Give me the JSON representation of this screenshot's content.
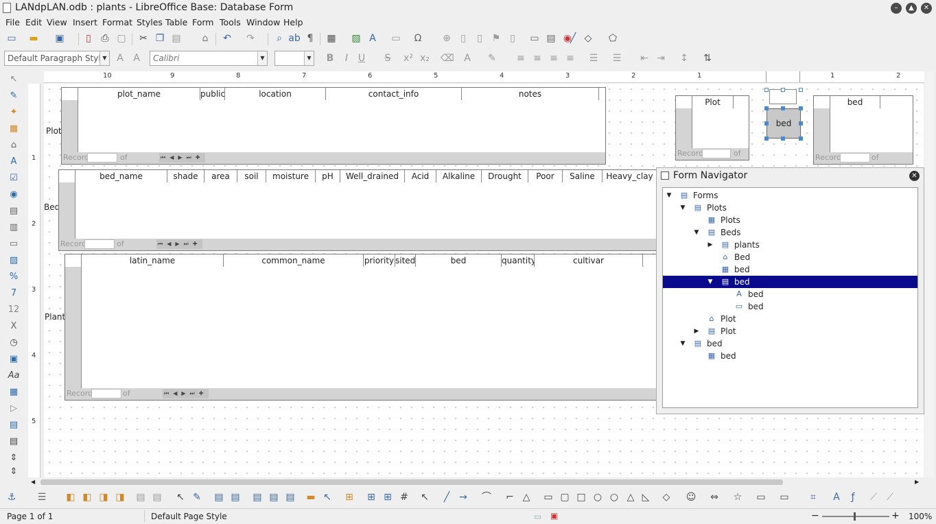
{
  "window": {
    "title": "LANdpLAN.odb : plants - LibreOffice Base: Database Form"
  },
  "menu": [
    "File",
    "Edit",
    "View",
    "Insert",
    "Format",
    "Styles",
    "Table",
    "Form",
    "Tools",
    "Window",
    "Help"
  ],
  "format_bar": {
    "paragraph_style": "Default Paragraph Style",
    "font_name": "Calibri",
    "font_size": ""
  },
  "ruler_numbers": [
    "10",
    "9",
    "8",
    "7",
    "6",
    "5",
    "4",
    "3",
    "2",
    "1",
    "1",
    "2"
  ],
  "vruler_numbers": [
    "1",
    "2",
    "3",
    "4",
    "5"
  ],
  "plot_grid": {
    "label": "Plot",
    "columns": [
      "plot_name",
      "public",
      "location",
      "contact_info",
      "notes"
    ]
  },
  "bed_grid": {
    "label": "Bed",
    "columns": [
      "bed_name",
      "shade",
      "area",
      "soil",
      "moisture",
      "pH",
      "Well_drained",
      "Acid",
      "Alkaline",
      "Drought",
      "Poor",
      "Saline",
      "Heavy_clay"
    ]
  },
  "plants_grid": {
    "label": "Plants",
    "columns": [
      "latin_name",
      "common_name",
      "priority",
      "sited",
      "bed",
      "quantity",
      "cultivar"
    ]
  },
  "nav_record": {
    "record": "Record",
    "of": "of"
  },
  "small_plot_grid": {
    "columns": [
      "Plot"
    ]
  },
  "small_bed_grid": {
    "columns": [
      "bed"
    ]
  },
  "selected_control": {
    "label": "bed"
  },
  "navigator": {
    "title": "Form Navigator",
    "tree": [
      {
        "label": "Forms",
        "icon": "forms-icon",
        "expander": "open"
      },
      {
        "label": "Plots",
        "icon": "form-icon",
        "expander": "open"
      },
      {
        "label": "Plots",
        "icon": "table-control-icon",
        "expander": ""
      },
      {
        "label": "Beds",
        "icon": "form-icon",
        "expander": "open"
      },
      {
        "label": "plants",
        "icon": "form-icon",
        "expander": "closed"
      },
      {
        "label": "Bed",
        "icon": "label-icon",
        "expander": ""
      },
      {
        "label": "bed",
        "icon": "grid-control-icon",
        "expander": ""
      },
      {
        "label": "bed",
        "icon": "form-icon",
        "expander": "open",
        "selected": true
      },
      {
        "label": "bed",
        "icon": "label-field-icon",
        "expander": ""
      },
      {
        "label": "bed",
        "icon": "textbox-icon",
        "expander": ""
      },
      {
        "label": "Plot",
        "icon": "label-icon",
        "expander": ""
      },
      {
        "label": "Plot",
        "icon": "form-icon",
        "expander": "closed"
      },
      {
        "label": "bed",
        "icon": "form-icon",
        "expander": "open"
      },
      {
        "label": "bed",
        "icon": "table-control-icon",
        "expander": ""
      }
    ]
  },
  "status": {
    "page": "Page 1 of 1",
    "page_style": "Default Page Style",
    "zoom": "100%"
  }
}
